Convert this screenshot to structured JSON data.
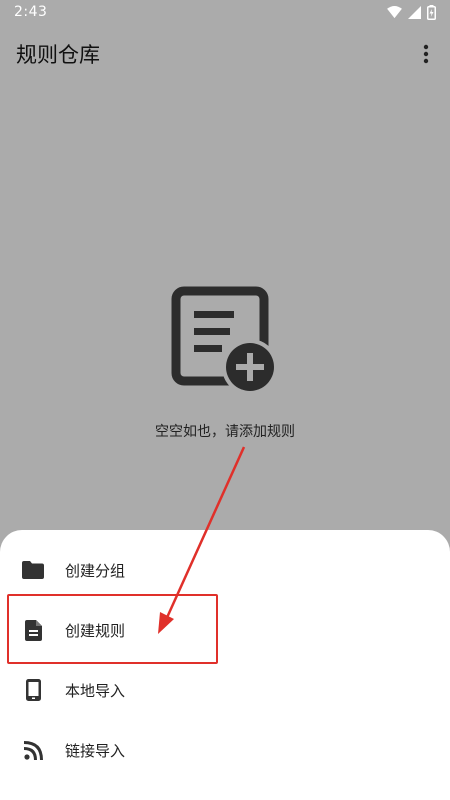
{
  "status_bar": {
    "time": "2:43"
  },
  "app_bar": {
    "title": "规则仓库"
  },
  "empty_state": {
    "message": "空空如也，请添加规则"
  },
  "bottom_sheet": {
    "items": [
      {
        "label": "创建分组",
        "icon": "folder-icon"
      },
      {
        "label": "创建规则",
        "icon": "file-icon"
      },
      {
        "label": "本地导入",
        "icon": "phone-icon"
      },
      {
        "label": "链接导入",
        "icon": "rss-icon"
      }
    ]
  },
  "annotation": {
    "color": "#e0302a",
    "highlighted_item": "创建规则"
  }
}
